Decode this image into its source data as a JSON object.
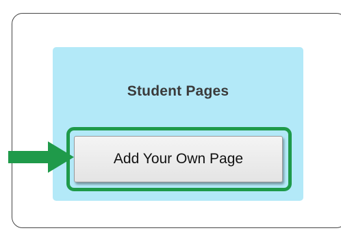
{
  "card": {
    "title": "Student Pages"
  },
  "actions": {
    "add_page_label": "Add Your Own Page"
  },
  "colors": {
    "card_background": "#b3e9f8",
    "highlight": "#1f9a4a",
    "arrow": "#1f9a4a"
  },
  "icons": {
    "pointer": "arrow-right-icon"
  }
}
